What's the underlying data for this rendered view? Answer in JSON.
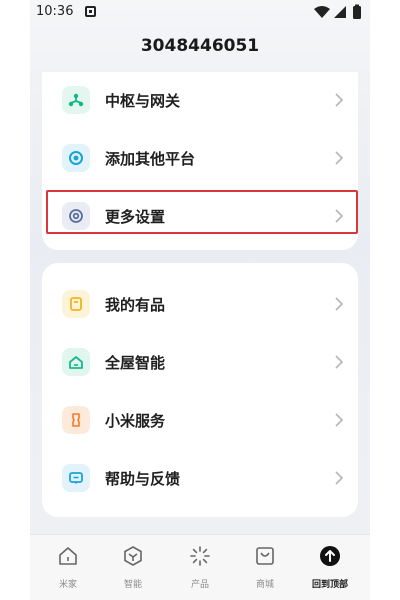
{
  "status_bar": {
    "time": "10:36"
  },
  "header": {
    "title": "3048446051"
  },
  "section1": {
    "items": [
      {
        "label": "中枢与网关",
        "icon": "hub-gateway-icon",
        "color": "#15b58a"
      },
      {
        "label": "添加其他平台",
        "icon": "add-platform-icon",
        "color": "#1aa3d6"
      },
      {
        "label": "更多设置",
        "icon": "settings-icon",
        "color": "#5a6f9a"
      }
    ]
  },
  "section2": {
    "items": [
      {
        "label": "我的有品",
        "icon": "youpin-icon",
        "color": "#f1b51c"
      },
      {
        "label": "全屋智能",
        "icon": "smart-home-icon",
        "color": "#19b98d"
      },
      {
        "label": "小米服务",
        "icon": "xiaomi-service-icon",
        "color": "#f07a2a"
      },
      {
        "label": "帮助与反馈",
        "icon": "help-feedback-icon",
        "color": "#1aa3d6"
      }
    ]
  },
  "nav": {
    "items": [
      {
        "label": "米家",
        "icon": "home-icon"
      },
      {
        "label": "智能",
        "icon": "smart-icon"
      },
      {
        "label": "产品",
        "icon": "product-icon"
      },
      {
        "label": "商城",
        "icon": "store-icon"
      },
      {
        "label": "回到顶部",
        "icon": "back-to-top-icon",
        "active": true
      }
    ]
  },
  "highlight_color": "#d9363e"
}
